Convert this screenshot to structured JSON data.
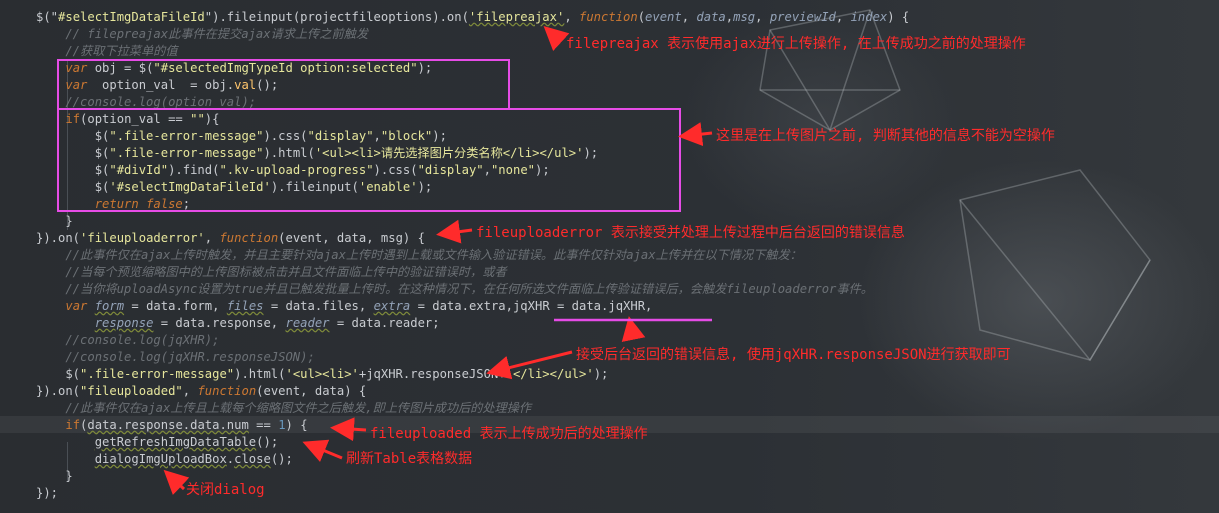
{
  "code_lines": [
    {
      "tokens": [
        [
          "n",
          "$(\""
        ],
        [
          "s",
          "#selectImgDataFileId"
        ],
        [
          "n",
          "\").fileinput(projectfileoptions).on("
        ],
        [
          "su",
          "'filepreajax'"
        ],
        [
          "n",
          ", "
        ],
        [
          "k",
          "function"
        ],
        [
          "n",
          "("
        ],
        [
          "p",
          "event"
        ],
        [
          "n",
          ", "
        ],
        [
          "p",
          "data"
        ],
        [
          "n",
          ","
        ],
        [
          "p",
          "msg"
        ],
        [
          "n",
          ", "
        ],
        [
          "p",
          "previewId"
        ],
        [
          "n",
          ", "
        ],
        [
          "p",
          "index"
        ],
        [
          "n",
          ") {"
        ]
      ]
    },
    {
      "tokens": [
        [
          "c",
          "    // filepreajax此事件在提交ajax请求上传之前触发"
        ]
      ]
    },
    {
      "tokens": [
        [
          "c",
          "    //获取下拉菜单的值"
        ]
      ]
    },
    {
      "tokens": [
        [
          "n",
          "    "
        ],
        [
          "k",
          "var"
        ],
        [
          "n",
          " obj = $("
        ],
        [
          "s",
          "\"#selectedImgTypeId option:selected\""
        ],
        [
          "n",
          ");"
        ]
      ]
    },
    {
      "tokens": [
        [
          "n",
          "    "
        ],
        [
          "k",
          "var"
        ],
        [
          "n",
          "  option_val  = obj."
        ],
        [
          "f",
          "val"
        ],
        [
          "n",
          "();"
        ]
      ]
    },
    {
      "tokens": [
        [
          "c",
          "    //console.log(option_val);"
        ]
      ]
    },
    {
      "tokens": [
        [
          "n",
          "    "
        ],
        [
          "kb",
          "if"
        ],
        [
          "n",
          "(option_val == "
        ],
        [
          "s",
          "\"\""
        ],
        [
          "n",
          "){"
        ]
      ]
    },
    {
      "tokens": [
        [
          "n",
          "        $("
        ],
        [
          "s",
          "\".file-error-message\""
        ],
        [
          "n",
          ").css("
        ],
        [
          "s",
          "\"display\""
        ],
        [
          "n",
          ","
        ],
        [
          "s",
          "\"block\""
        ],
        [
          "n",
          ");"
        ]
      ]
    },
    {
      "tokens": [
        [
          "n",
          "        $("
        ],
        [
          "s",
          "\".file-error-message\""
        ],
        [
          "n",
          ").html("
        ],
        [
          "s",
          "'<ul><li>请先选择图片分类名称</li></ul>'"
        ],
        [
          "n",
          ");"
        ]
      ]
    },
    {
      "tokens": [
        [
          "n",
          "        $("
        ],
        [
          "s",
          "\"#divId\""
        ],
        [
          "n",
          ").find("
        ],
        [
          "s",
          "\".kv-upload-progress\""
        ],
        [
          "n",
          ").css("
        ],
        [
          "s",
          "\"display\""
        ],
        [
          "n",
          ","
        ],
        [
          "s",
          "\"none\""
        ],
        [
          "n",
          ");"
        ]
      ]
    },
    {
      "tokens": [
        [
          "n",
          "        $("
        ],
        [
          "s",
          "'#selectImgDataFileId'"
        ],
        [
          "n",
          ").fileinput("
        ],
        [
          "s",
          "'enable'"
        ],
        [
          "n",
          ");"
        ]
      ]
    },
    {
      "tokens": [
        [
          "n",
          "        "
        ],
        [
          "k",
          "return false"
        ],
        [
          "n",
          ";"
        ]
      ]
    },
    {
      "tokens": [
        [
          "n",
          "    }"
        ]
      ]
    },
    {
      "tokens": [
        [
          "n",
          "}).on("
        ],
        [
          "s",
          "'fileuploaderror'"
        ],
        [
          "n",
          ", "
        ],
        [
          "k",
          "function"
        ],
        [
          "n",
          "(event, data, msg) {"
        ]
      ]
    },
    {
      "tokens": [
        [
          "c",
          "    //此事件仅在ajax上传时触发，并且主要针对ajax上传时遇到上载或文件输入验证错误。此事件仅针对ajax上传并在以下情况下触发："
        ]
      ]
    },
    {
      "tokens": [
        [
          "c",
          "    //当每个预览缩略图中的上传图标被点击并且文件面临上传中的验证错误时，或者"
        ]
      ]
    },
    {
      "tokens": [
        [
          "c",
          "    //当你将uploadAsync设置为true并且已触发批量上传时。在这种情况下，在任何所选文件面临上传验证错误后，会触发fileuploaderror事件。"
        ]
      ]
    },
    {
      "tokens": [
        [
          "n",
          "    "
        ],
        [
          "k",
          "var"
        ],
        [
          "n",
          " "
        ],
        [
          "pu",
          "form"
        ],
        [
          "n",
          " = data.form, "
        ],
        [
          "pu",
          "files"
        ],
        [
          "n",
          " = data.files, "
        ],
        [
          "pu",
          "extra"
        ],
        [
          "n",
          " = data.extra,jqXHR = data.jqXHR,"
        ]
      ]
    },
    {
      "tokens": [
        [
          "n",
          "        "
        ],
        [
          "pu",
          "response"
        ],
        [
          "n",
          " = data.response, "
        ],
        [
          "pu",
          "reader"
        ],
        [
          "n",
          " = data.reader;"
        ]
      ]
    },
    {
      "tokens": [
        [
          "c",
          "    //console.log(jqXHR);"
        ]
      ]
    },
    {
      "tokens": [
        [
          "c",
          "    //console.log(jqXHR.responseJSON);"
        ]
      ]
    },
    {
      "tokens": [
        [
          "n",
          "    $("
        ],
        [
          "s",
          "\".file-error-message\""
        ],
        [
          "n",
          ").html("
        ],
        [
          "s",
          "'<ul><li>'"
        ],
        [
          "n",
          "+jqXHR.responseJSON+"
        ],
        [
          "s",
          "'</li></ul>'"
        ],
        [
          "n",
          ");"
        ]
      ]
    },
    {
      "tokens": [
        [
          "n",
          "}).on("
        ],
        [
          "s",
          "\"fileuploaded\""
        ],
        [
          "n",
          ", "
        ],
        [
          "k",
          "function"
        ],
        [
          "n",
          "(event, data) {"
        ]
      ]
    },
    {
      "tokens": [
        [
          "c",
          "    //此事件仅在ajax上传且上载每个缩略图文件之后触发,即上传图片成功后的处理操作"
        ]
      ]
    },
    {
      "tokens": [
        [
          "n",
          "    "
        ],
        [
          "kb",
          "if"
        ],
        [
          "n",
          "("
        ],
        [
          "u",
          "data.response.data.num"
        ],
        [
          "n",
          " == "
        ],
        [
          "num",
          "1"
        ],
        [
          "n",
          ") {"
        ]
      ]
    },
    {
      "tokens": [
        [
          "n",
          "        "
        ],
        [
          "u",
          "getRefreshImgDataTable"
        ],
        [
          "n",
          "();"
        ]
      ]
    },
    {
      "tokens": [
        [
          "n",
          "        "
        ],
        [
          "u",
          "dialogImgUploadBox"
        ],
        [
          "n",
          "."
        ],
        [
          "u",
          "close"
        ],
        [
          "n",
          "();"
        ]
      ]
    },
    {
      "tokens": [
        [
          "n",
          "    }"
        ]
      ]
    },
    {
      "tokens": [
        [
          "n",
          "});"
        ]
      ]
    }
  ],
  "annotations": {
    "filepreajax": "filepreajax 表示使用ajax进行上传操作, 在上传成功之前的处理操作",
    "validate": "这里是在上传图片之前, 判断其他的信息不能为空操作",
    "fileuploaderror": "fileuploaderror 表示接受并处理上传过程中后台返回的错误信息",
    "jqxhr": "接受后台返回的错误信息, 使用jqXHR.responseJSON进行获取即可",
    "fileuploaded": "fileuploaded 表示上传成功后的处理操作",
    "refresh": "刷新Table表格数据",
    "close": "关闭dialog"
  },
  "colors": {
    "background": "#2b2f33",
    "keyword": "#cc7832",
    "string": "#e6e69c",
    "comment": "#6b7075",
    "annotation": "#ff2b2b",
    "box": "#e64ce6"
  }
}
